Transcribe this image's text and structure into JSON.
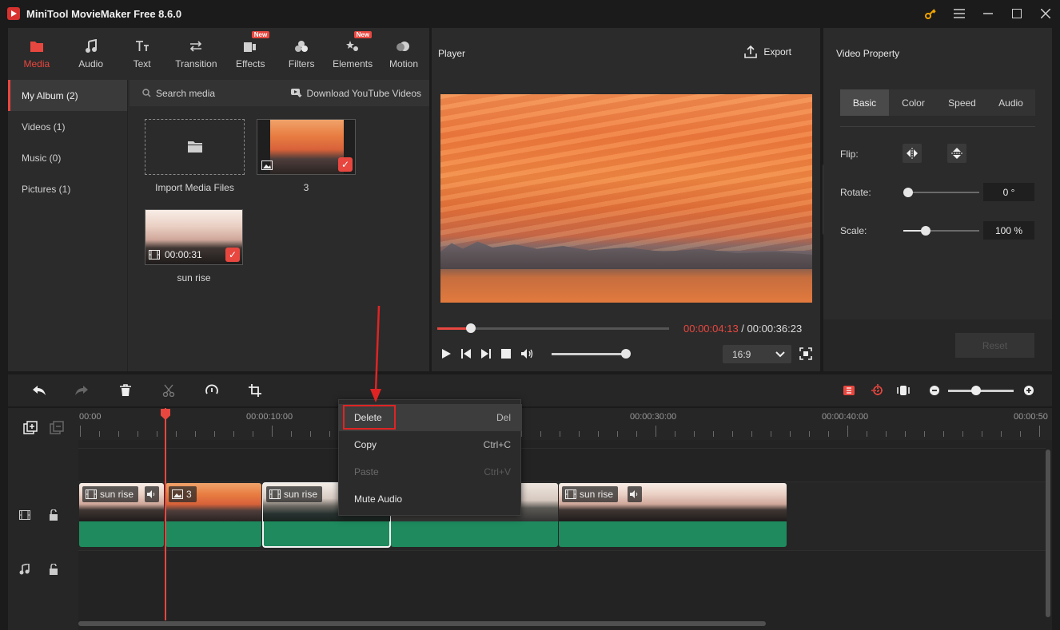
{
  "app": {
    "title": "MiniTool MovieMaker Free 8.6.0"
  },
  "nav_tabs": [
    {
      "label": "Media",
      "icon": "folder-icon",
      "active": true,
      "new": false
    },
    {
      "label": "Audio",
      "icon": "music-note-icon",
      "new": false
    },
    {
      "label": "Text",
      "icon": "text-icon",
      "new": false
    },
    {
      "label": "Transition",
      "icon": "transition-arrows-icon",
      "new": false
    },
    {
      "label": "Effects",
      "icon": "effects-icon",
      "new": true
    },
    {
      "label": "Filters",
      "icon": "filters-icon",
      "new": false
    },
    {
      "label": "Elements",
      "icon": "elements-icon",
      "new": true
    },
    {
      "label": "Motion",
      "icon": "motion-icon",
      "new": false
    }
  ],
  "new_badge": "New",
  "album": [
    {
      "label": "My Album (2)",
      "active": true
    },
    {
      "label": "Videos (1)"
    },
    {
      "label": "Music (0)"
    },
    {
      "label": "Pictures (1)"
    }
  ],
  "media_toolbar": {
    "search": "Search media",
    "download": "Download YouTube Videos"
  },
  "media": {
    "import_label": "Import Media Files",
    "items": [
      {
        "name": "3",
        "kind": "picture",
        "selected": true
      },
      {
        "name": "sun rise",
        "kind": "video",
        "duration": "00:00:31",
        "selected": true
      }
    ]
  },
  "player": {
    "title": "Player",
    "export_label": "Export",
    "current_time": "00:00:04:13",
    "separator": " / ",
    "total_time": "00:00:36:23",
    "progress": 0.14,
    "volume": 0.95,
    "aspect_ratio": "16:9"
  },
  "property": {
    "title": "Video Property",
    "tabs": [
      "Basic",
      "Color",
      "Speed",
      "Audio"
    ],
    "active_tab": "Basic",
    "flip_label": "Flip:",
    "rotate_label": "Rotate:",
    "rotate_value": "0 °",
    "rotate_level": 0.0,
    "scale_label": "Scale:",
    "scale_value": "100 %",
    "scale_level": 0.3,
    "reset_label": "Reset"
  },
  "timeline": {
    "ruler_labels": [
      "00:00",
      "00:00:10:00",
      "00:00:30:00",
      "00:00:40:00",
      "00:00:50"
    ],
    "clips": [
      {
        "label": "sun rise",
        "kind": "video",
        "audio": true
      },
      {
        "label": "3",
        "kind": "picture",
        "audio": false
      },
      {
        "label": "sun rise",
        "kind": "video",
        "audio": true,
        "selected": true
      },
      {
        "label": "",
        "kind": "video",
        "audio": false
      },
      {
        "label": "sun rise",
        "kind": "video",
        "audio": true
      }
    ],
    "zoom_level": 0.45
  },
  "context_menu": {
    "items": [
      {
        "label": "Delete",
        "shortcut": "Del",
        "enabled": true,
        "highlighted": true
      },
      {
        "label": "Copy",
        "shortcut": "Ctrl+C",
        "enabled": true
      },
      {
        "label": "Paste",
        "shortcut": "Ctrl+V",
        "enabled": false
      },
      {
        "label": "Mute Audio",
        "shortcut": "",
        "enabled": true
      }
    ]
  },
  "colors": {
    "accent": "#e8473f",
    "clip_green": "#1e8a5e",
    "annotation_red": "#e02424"
  }
}
